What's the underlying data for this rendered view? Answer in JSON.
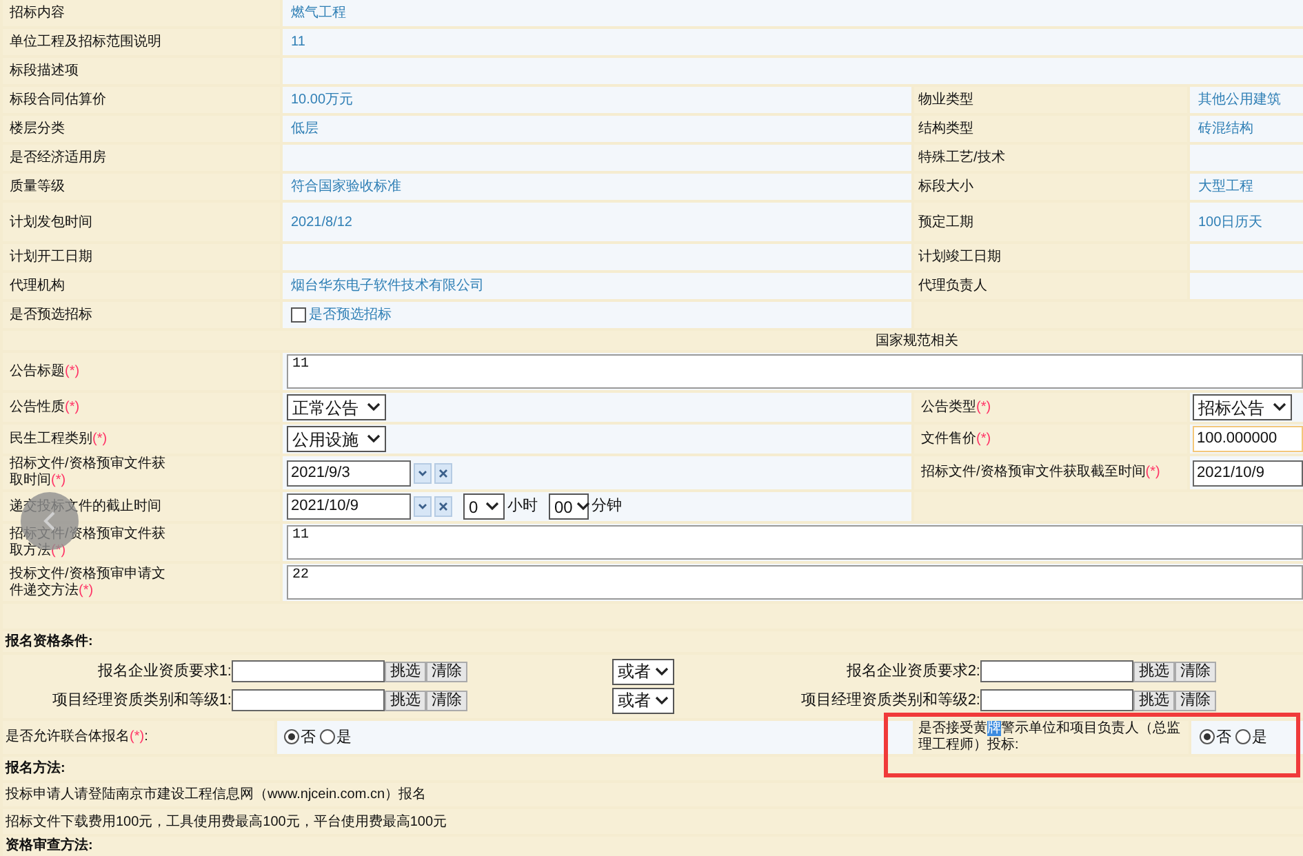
{
  "info_rows": [
    {
      "kind": "text",
      "label": "招标内容",
      "value": "燃气工程"
    },
    {
      "kind": "text",
      "label": "单位工程及招标范围说明",
      "value": "11"
    },
    {
      "kind": "text",
      "label": "标段描述项"
    },
    {
      "kind": "text",
      "label": "标段合同估算价",
      "value": "10.00万元",
      "right_label": "物业类型",
      "right_value": "其他公用建筑"
    },
    {
      "kind": "text",
      "label": "楼层分类",
      "value": "低层",
      "right_label": "结构类型",
      "right_value": "砖混结构"
    },
    {
      "kind": "text",
      "label": "是否经济适用房",
      "right_label": "特殊工艺/技术"
    },
    {
      "kind": "text",
      "label": "质量等级",
      "value": "符合国家验收标准",
      "right_label": "标段大小",
      "right_value": "大型工程"
    },
    {
      "kind": "text",
      "label": "计划发包时间",
      "value": "2021/8/12",
      "right_label": "预定工期",
      "right_value": "100日历天",
      "tall": true
    },
    {
      "kind": "text",
      "label": "计划开工日期",
      "right_label": "计划竣工日期"
    },
    {
      "kind": "text",
      "label": "代理机构",
      "value": "烟台华东电子软件技术有限公司",
      "right_label": "代理负责人"
    },
    {
      "kind": "checkbox",
      "label": "是否预选招标",
      "checkbox_label": "是否预选招标",
      "checked": false
    }
  ],
  "section_title": "国家规范相关",
  "form_rows": [
    {
      "label": "公告标题",
      "required_mark": "(*)",
      "field": {
        "kind": "textarea",
        "value": "11"
      }
    },
    {
      "label": "公告性质",
      "required_mark": "(*)",
      "field": {
        "kind": "select",
        "value": "正常公告"
      },
      "right": {
        "label": "公告类型",
        "required_mark": "(*)",
        "field": {
          "kind": "select",
          "value": "招标公告"
        }
      }
    },
    {
      "label": "民生工程类别",
      "required_mark": "(*)",
      "field": {
        "kind": "select",
        "value": "公用设施"
      },
      "right": {
        "label": "文件售价",
        "required_mark": "(*)",
        "field": {
          "kind": "input",
          "value": "100.000000",
          "focused": true
        }
      }
    },
    {
      "label": "招标文件/资格预审文件获取时间",
      "required_mark": "(*)",
      "field": {
        "kind": "date",
        "value": "2021/9/3"
      },
      "right": {
        "label": "招标文件/资格预审文件获取截至时间",
        "required_mark": "(*)",
        "field": {
          "kind": "input",
          "value": "2021/10/9",
          "focused": false
        }
      }
    },
    {
      "label": "递交投标文件的截止时间",
      "field": {
        "kind": "datetime",
        "value": "2021/10/9",
        "hour": "0",
        "hour_unit": "小时",
        "minute": "00",
        "minute_unit": "分钟"
      }
    },
    {
      "label": "招标文件/资格预审文件获取方法",
      "required_mark": "(*)",
      "field": {
        "kind": "textarea",
        "value": "11"
      }
    },
    {
      "label": "投标文件/资格预审申请文件递交方法",
      "required_mark": "(*)",
      "field": {
        "kind": "textarea",
        "value": "22"
      }
    }
  ],
  "qualification": {
    "title": "报名资格条件:",
    "rows": [
      {
        "label": "报名企业资质要求1:",
        "pick": "挑选",
        "clear": "清除",
        "connector": "或者",
        "right_label": "报名企业资质要求2:",
        "right_pick": "挑选",
        "right_clear": "清除"
      },
      {
        "label": "项目经理资质类别和等级1:",
        "pick": "挑选",
        "clear": "清除",
        "connector": "或者",
        "right_label": "项目经理资质类别和等级2:",
        "right_pick": "挑选",
        "right_clear": "清除"
      }
    ]
  },
  "consortium": {
    "label": "是否允许联合体报名",
    "required_mark": "(*)",
    "colon": ":",
    "options": [
      {
        "label": "否",
        "selected": true
      },
      {
        "label": "是",
        "selected": false
      }
    ]
  },
  "warning_question": {
    "label_before": "是否接受黄",
    "label_selected": "牌",
    "label_after": "警示单位和项目负责人（总监理工程师）投标:",
    "options": [
      {
        "label": "否",
        "selected": true
      },
      {
        "label": "是",
        "selected": false
      }
    ]
  },
  "signup": {
    "title": "报名方法:",
    "lines": [
      "投标申请人请登陆南京市建设工程信息网（www.njcein.com.cn）报名",
      "招标文件下载费用100元，工具使用费最高100元，平台使用费最高100元"
    ]
  },
  "review_title": "资格审查方法:"
}
